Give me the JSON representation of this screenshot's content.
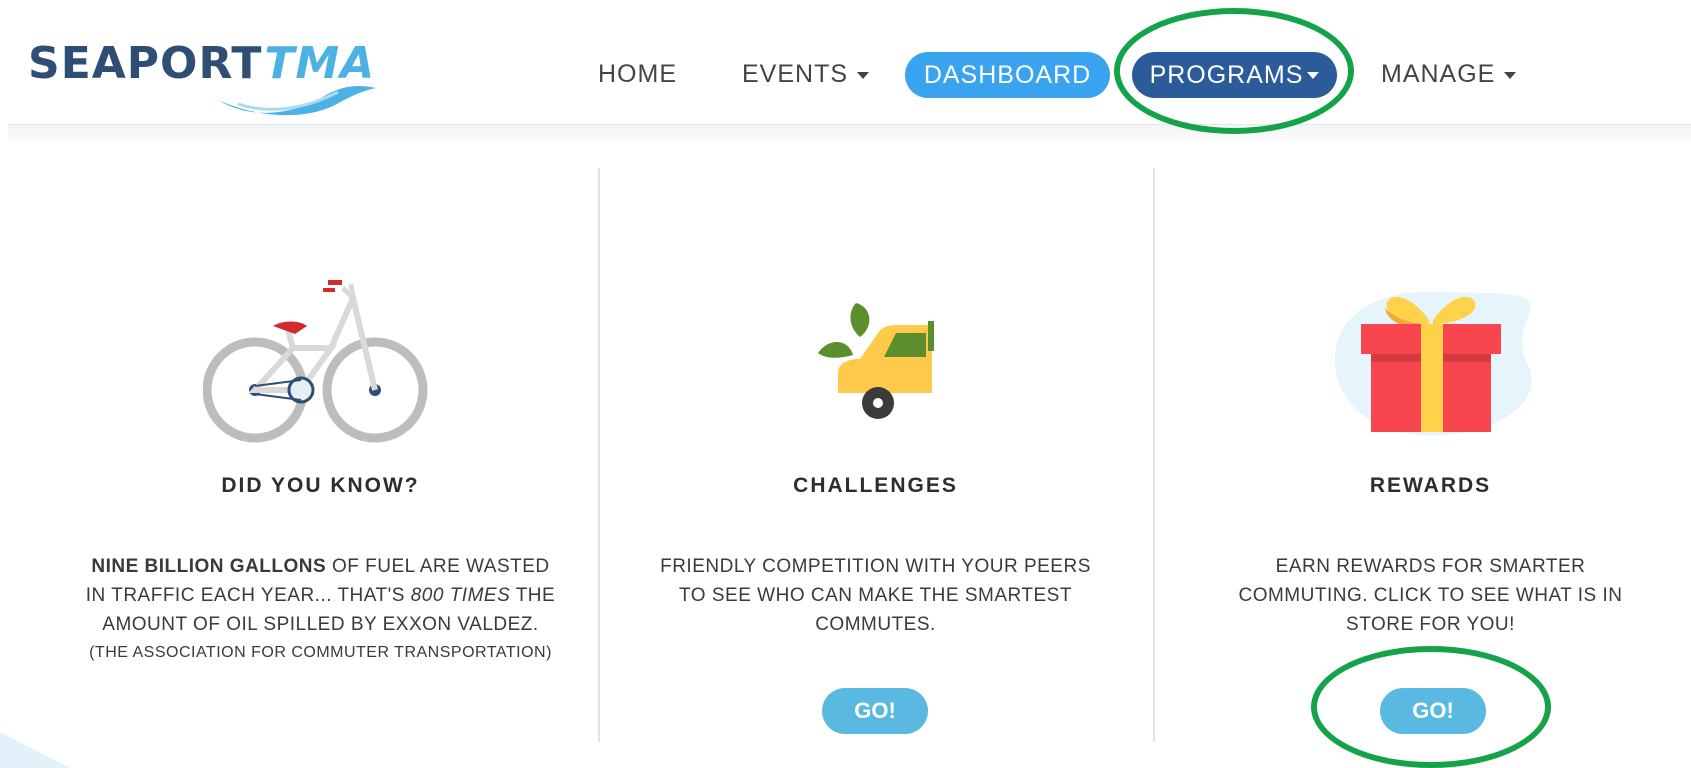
{
  "logo": {
    "seaport": "SEAPORT",
    "tma": "TMA"
  },
  "nav": {
    "home": "HOME",
    "events": "EVENTS",
    "dashboard": "DASHBOARD",
    "programs": "PROGRAMS",
    "manage": "MANAGE"
  },
  "cards": [
    {
      "icon": "bicycle-icon",
      "title": "DID YOU KNOW?",
      "text_bold": "NINE BILLION GALLONS",
      "text_1": " OF FUEL ARE WASTED IN TRAFFIC EACH YEAR... THAT'S ",
      "text_italic": "800 TIMES",
      "text_2": " THE AMOUNT OF OIL SPILLED BY EXXON VALDEZ.",
      "note": "(THE ASSOCIATION FOR COMMUTER TRANSPORTATION)"
    },
    {
      "icon": "eco-car-icon",
      "title": "CHALLENGES",
      "text": "FRIENDLY COMPETITION WITH YOUR PEERS TO SEE WHO CAN MAKE THE SMARTEST COMMUTES.",
      "button": "GO!"
    },
    {
      "icon": "gift-icon",
      "title": "REWARDS",
      "text": "EARN REWARDS FOR SMARTER COMMUTING. CLICK TO SEE WHAT IS IN STORE FOR YOU!",
      "button": "GO!"
    }
  ],
  "colors": {
    "brand_dark": "#2f4e76",
    "brand_light": "#4cb1e3",
    "dashboard_pill": "#3aa3ef",
    "programs_pill": "#2b5c99",
    "go_button": "#5ab9e0",
    "highlight_ring": "#15a349"
  }
}
